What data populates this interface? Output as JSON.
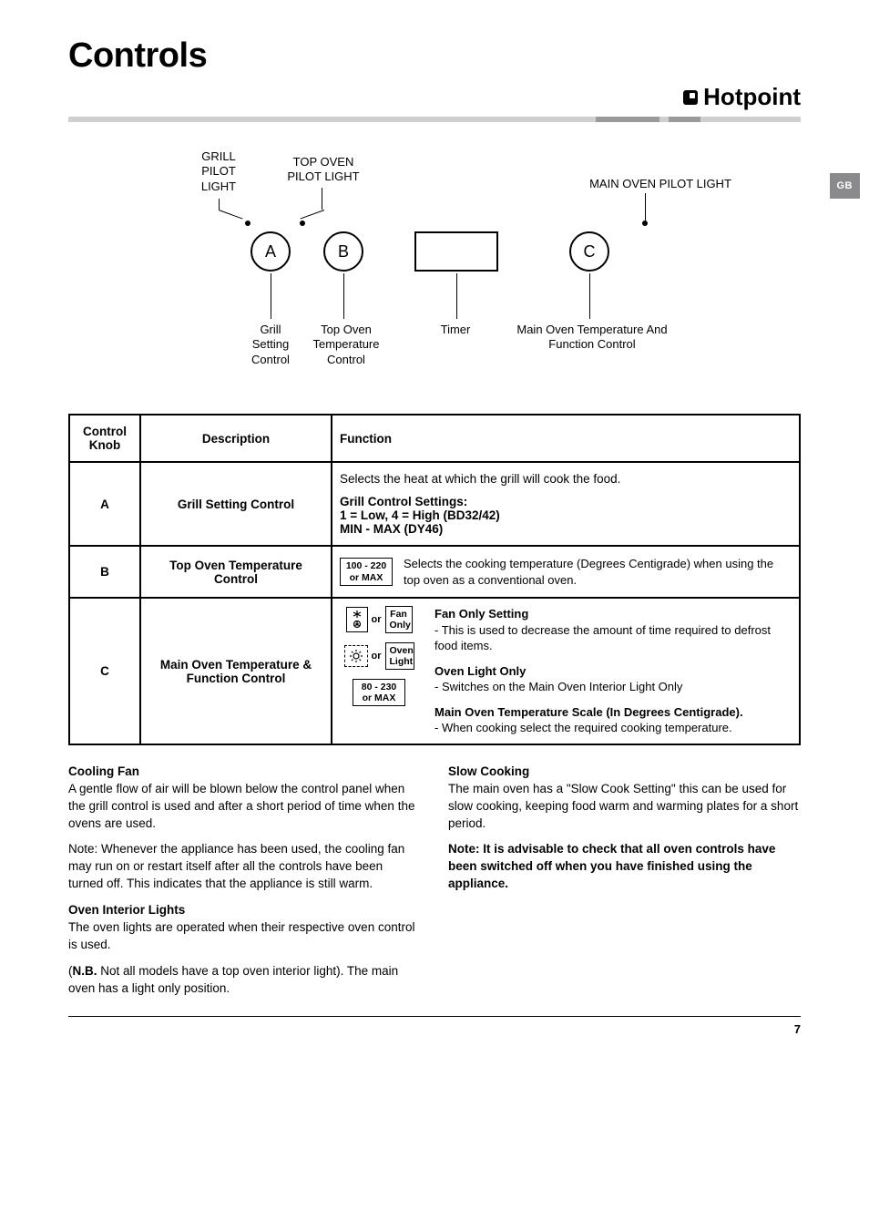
{
  "page": {
    "title": "Controls",
    "brand": "Hotpoint",
    "lang_tab": "GB",
    "number": "7"
  },
  "diagram": {
    "grill_pilot": "GRILL PILOT LIGHT",
    "top_oven_pilot": "TOP OVEN PILOT LIGHT",
    "main_oven_pilot": "MAIN OVEN PILOT LIGHT",
    "knob_a": "A",
    "knob_b": "B",
    "knob_c": "C",
    "grill_setting": "Grill Setting Control",
    "top_oven_temp": "Top Oven Temperature Control",
    "timer": "Timer",
    "main_oven_temp_func": "Main Oven Temperature And Function Control"
  },
  "table": {
    "headers": {
      "knob": "Control Knob",
      "desc": "Description",
      "func": "Function"
    },
    "rowA": {
      "knob": "A",
      "desc": "Grill Setting Control",
      "line1": "Selects the heat at which the grill will cook the food.",
      "settings_h": "Grill Control Settings:",
      "settings_1": "1 = Low, 4 = High (BD32/42)",
      "settings_2": "MIN - MAX (DY46)"
    },
    "rowB": {
      "knob": "B",
      "desc": "Top Oven Temperature Control",
      "box": "100 - 220 or MAX",
      "text": "Selects the cooking temperature (Degrees Centigrade) when using the top oven as a conventional oven."
    },
    "rowC": {
      "knob": "C",
      "desc": "Main Oven Temperature & Function Control",
      "fan_label": "Fan Only",
      "oven_light_label": "Oven Light",
      "box3": "80 - 230 or MAX",
      "or": "or",
      "fan_h": "Fan Only Setting",
      "fan_t": "- This is used to decrease the amount of time required to defrost food items.",
      "light_h": "Oven Light Only",
      "light_t": "- Switches on the Main Oven Interior Light Only",
      "scale_h": "Main Oven Temperature Scale (In Degrees Centigrade).",
      "scale_t": "- When cooking select the required cooking temperature."
    }
  },
  "body": {
    "cooling_h": "Cooling Fan",
    "cooling_p1": "A gentle flow of air will be blown below the control panel when the grill control is used and after a short period of time when the ovens are used.",
    "cooling_p2": "Note: Whenever the appliance has been used, the cooling fan may run on or restart itself after all the controls have been turned off. This indicates that the appliance is still warm.",
    "lights_h": "Oven Interior Lights",
    "lights_p1": "The oven lights are operated when their respective oven control is used.",
    "lights_nb": "N.B.",
    "lights_p2a": "(",
    "lights_p2b": " Not all models have a top oven interior light). The main oven has a light only position.",
    "slow_h": "Slow Cooking",
    "slow_p1": "The main oven has a \"Slow Cook Setting\" this can be used for slow cooking, keeping food warm and warming plates for a short period.",
    "note": "Note: It is advisable to check that all oven controls have been switched off when you have finished using the appliance."
  }
}
